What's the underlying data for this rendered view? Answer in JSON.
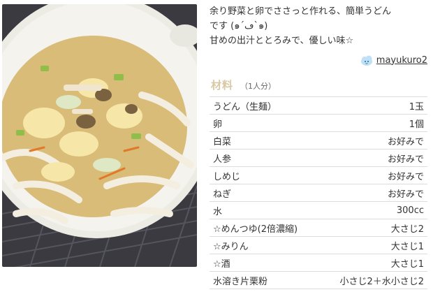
{
  "description": {
    "lines": [
      "余り野菜と卵でささっと作れる、簡単うどん",
      "です (๑´ڡ`๑)",
      "甘めの出汁ととろみで、優しい味☆"
    ]
  },
  "author": {
    "name": "mayukuro2",
    "avatar_icon": "cloud-avatar-icon"
  },
  "ingredients": {
    "title": "材料",
    "serving": "（1人分）",
    "items": [
      {
        "name": "うどん（生麺）",
        "qty": "1玉"
      },
      {
        "name": "卵",
        "qty": "1個"
      },
      {
        "name": "白菜",
        "qty": "お好みで"
      },
      {
        "name": "人参",
        "qty": "お好みで"
      },
      {
        "name": "しめじ",
        "qty": "お好みで"
      },
      {
        "name": "ねぎ",
        "qty": "お好みで"
      },
      {
        "name": "水",
        "qty": "300cc"
      },
      {
        "name": "☆めんつゆ(2倍濃縮)",
        "qty": "大さじ2"
      },
      {
        "name": "☆みりん",
        "qty": "大さじ1"
      },
      {
        "name": "☆酒",
        "qty": "大さじ1"
      },
      {
        "name": "水溶き片栗粉",
        "qty": "小さじ2＋水小さじ2"
      }
    ]
  },
  "colors": {
    "title_accent": "#d8c9a5",
    "divider": "#dcdcdc"
  }
}
